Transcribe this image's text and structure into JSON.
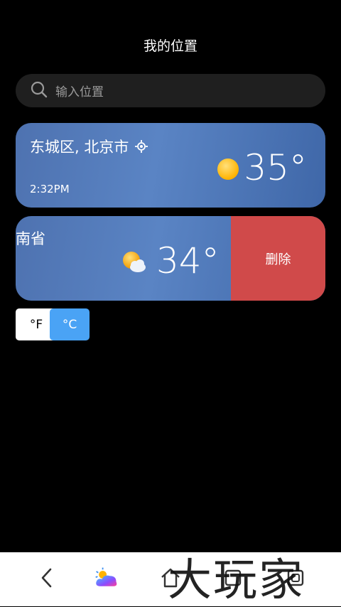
{
  "header": {
    "title": "我的位置"
  },
  "search": {
    "placeholder": "输入位置",
    "icon": "search-icon"
  },
  "locations": [
    {
      "name": "东城区, 北京市",
      "time": "2:32PM",
      "temp": "35°",
      "condition_icon": "sunny-icon",
      "current_location": true
    },
    {
      "name": "南省",
      "temp": "34°",
      "condition_icon": "partly-cloudy-icon",
      "delete_label": "删除"
    }
  ],
  "units": {
    "fahrenheit": "°F",
    "celsius": "°C",
    "selected": "°C"
  },
  "navbar": {
    "watermark": "大玩家"
  },
  "colors": {
    "accent": "#4aa3f5",
    "delete": "#d04a4a",
    "card": "#5a84c4"
  }
}
